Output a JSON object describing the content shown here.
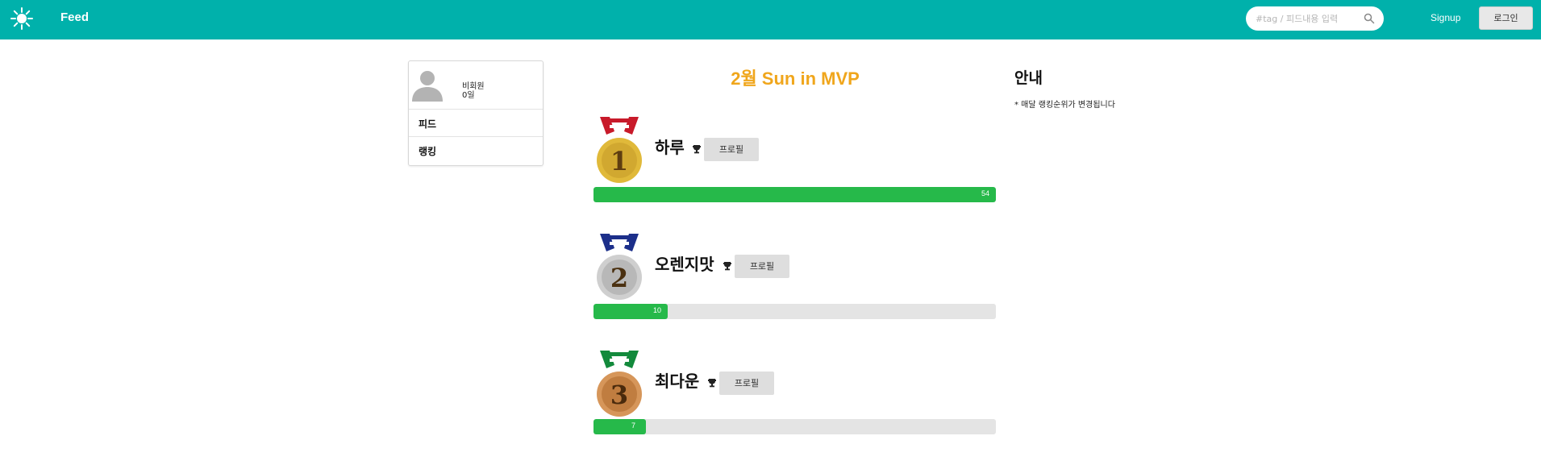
{
  "navbar": {
    "brand": "Feed",
    "search_placeholder": "#tag / 피드내용 입력",
    "signup_label": "Signup",
    "login_label": "로그인",
    "bg_color": "#00b1ab"
  },
  "sidebar": {
    "user_name": "비회원",
    "user_count": "0일",
    "items": [
      {
        "label": "피드"
      },
      {
        "label": "랭킹"
      }
    ]
  },
  "ranking": {
    "title": "2월 Sun in MVP",
    "title_color": "#f0a61c",
    "profile_label": "프로필",
    "bar_color": "#26b94a",
    "entries": [
      {
        "rank": "1",
        "name": "하루",
        "score": 54,
        "fill": 1.0,
        "medal_ribbon": "#c81a2a",
        "medal_metal": "#e0b93a"
      },
      {
        "rank": "2",
        "name": "오렌지맛",
        "score": 10,
        "fill": 0.185,
        "medal_ribbon": "#1c2f8a",
        "medal_metal": "#c9c9c9"
      },
      {
        "rank": "3",
        "name": "최다운",
        "score": 7,
        "fill": 0.13,
        "medal_ribbon": "#138a3c",
        "medal_metal": "#cd8a4c"
      }
    ]
  },
  "info": {
    "title": "안내",
    "text": "* 매달 랭킹순위가 변경됩니다"
  }
}
